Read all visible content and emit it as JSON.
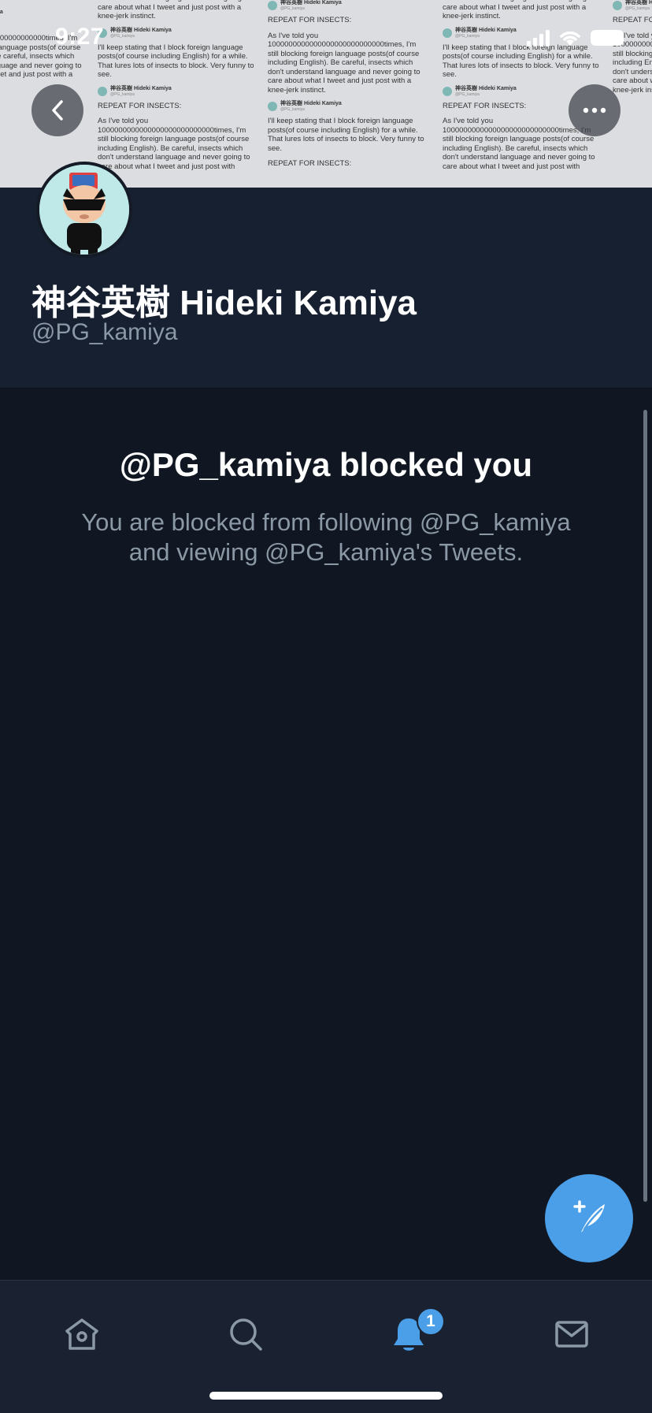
{
  "status_bar": {
    "time": "9:27"
  },
  "banner": {
    "columns": [
      {
        "p1": "don't understand language and never going to care about what I tweet and just post with a knee-jerk instinct.",
        "name": "神谷英樹 Hideki Kamiya",
        "handle": "@PG_kamiya",
        "p2": "I'll keep stating that I block foreign language posts(of course including English) for a while. That lures lots of insects to block. Very funny to see.",
        "p3": "REPEAT FOR INSECTS:",
        "p4": "As I've told you 1000000000000000000000000000times, I'm still blocking foreign language posts(of course including English). Be careful, insects which don't understand language and never going to care about what I tweet and just post with"
      },
      {
        "p1": "REPEAT FOR INSECTS:",
        "name": "神谷英樹 Hideki Kamiya",
        "handle": "@PG_kamiya",
        "p2": "As I've told you 1000000000000000000000000000times, I'm still blocking foreign language posts(of course including English). Be careful, insects which don't understand language and never going to care about what I tweet and just post with a knee-jerk instinct.",
        "p3": "I'll keep stating that I block foreign language posts(of course including English) for a while. That lures lots of insects to block. Very funny to see.",
        "p4": "REPEAT FOR INSECTS:"
      }
    ]
  },
  "profile": {
    "name": "神谷英樹 Hideki Kamiya",
    "handle": "@PG_kamiya"
  },
  "blocked": {
    "title": "@PG_kamiya blocked you",
    "description": "You are blocked from following @PG_kamiya and viewing @PG_kamiya's Tweets."
  },
  "tabbar": {
    "notifications_badge": "1"
  },
  "colors": {
    "accent": "#4a9fe8",
    "background": "#111722",
    "secondary_text": "#8b98a5"
  },
  "icons": [
    "back-arrow-icon",
    "more-icon",
    "compose-tweet-icon",
    "home-icon",
    "search-icon",
    "bell-icon",
    "mail-icon"
  ]
}
